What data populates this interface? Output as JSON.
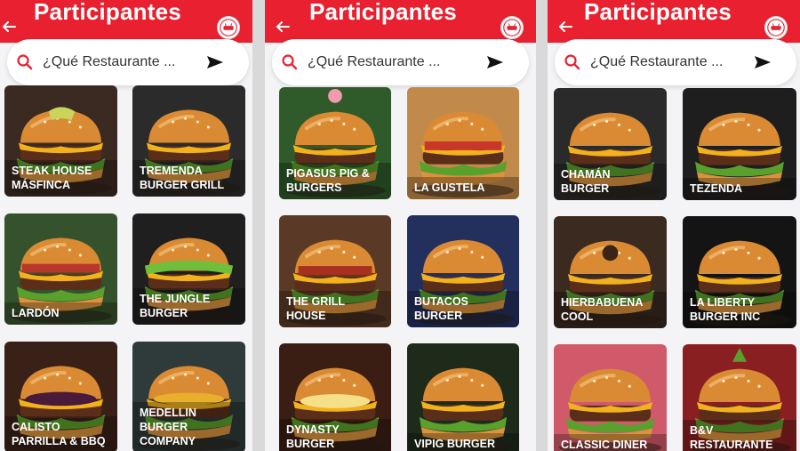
{
  "colors": {
    "brand_red": "#e8202f",
    "background": "#f4f4f6",
    "text_white": "#ffffff"
  },
  "header": {
    "title": "Participantes",
    "back_icon": "arrow-left-icon",
    "logo_icon": "festival-logo-icon"
  },
  "search": {
    "placeholder": "¿Qué Restaurante ...",
    "search_icon": "search-icon",
    "submit_icon": "send-icon"
  },
  "panels": [
    {
      "restaurants": [
        {
          "name": "STEAK HOUSE MÁSFINCA"
        },
        {
          "name": "TREMENDA BURGER GRILL"
        },
        {
          "name": "LARDÓN"
        },
        {
          "name": "THE JUNGLE BURGER"
        },
        {
          "name": "CALISTO PARRILLA & BBQ"
        },
        {
          "name": "MEDELLIN BURGER COMPANY"
        }
      ]
    },
    {
      "restaurants": [
        {
          "name": "PIGASUS PIG & BURGERS"
        },
        {
          "name": "LA GUSTELA"
        },
        {
          "name": "THE GRILL HOUSE"
        },
        {
          "name": "BUTACOS BURGER"
        },
        {
          "name": "DYNASTY BURGER"
        },
        {
          "name": "VIPIG BURGER"
        }
      ]
    },
    {
      "restaurants": [
        {
          "name": "CHAMÁN BURGER"
        },
        {
          "name": "TEZENDA"
        },
        {
          "name": "HIERBABUENA COOL"
        },
        {
          "name": "LA LIBERTY BURGER INC"
        },
        {
          "name": "CLASSIC DINER"
        },
        {
          "name": "B&V RESTAURANTE"
        }
      ]
    }
  ]
}
